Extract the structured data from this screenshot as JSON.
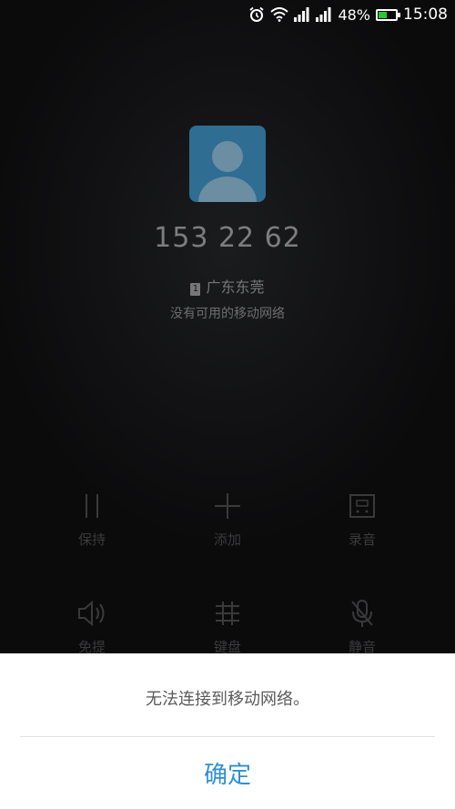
{
  "status_bar": {
    "battery_percent": "48%",
    "battery_level": 0.48,
    "time": "15:08",
    "icons": [
      "alarm-icon",
      "wifi-icon",
      "signal-icon",
      "signal-icon",
      "battery-icon"
    ]
  },
  "call": {
    "number": "153 22     62",
    "location": "广东东莞",
    "sim_slot": "1",
    "status": "没有可用的移动网络"
  },
  "controls": [
    {
      "label": "保持",
      "icon": "pause-icon"
    },
    {
      "label": "添加",
      "icon": "plus-icon"
    },
    {
      "label": "录音",
      "icon": "record-icon"
    },
    {
      "label": "免提",
      "icon": "speaker-icon"
    },
    {
      "label": "键盘",
      "icon": "keypad-icon"
    },
    {
      "label": "静音",
      "icon": "mute-icon"
    }
  ],
  "dialog": {
    "message": "无法连接到移动网络。",
    "confirm_label": "确定"
  },
  "colors": {
    "accent": "#2f8fd0",
    "avatar_bg": "#2f6d92",
    "battery_fill": "#28c832"
  }
}
